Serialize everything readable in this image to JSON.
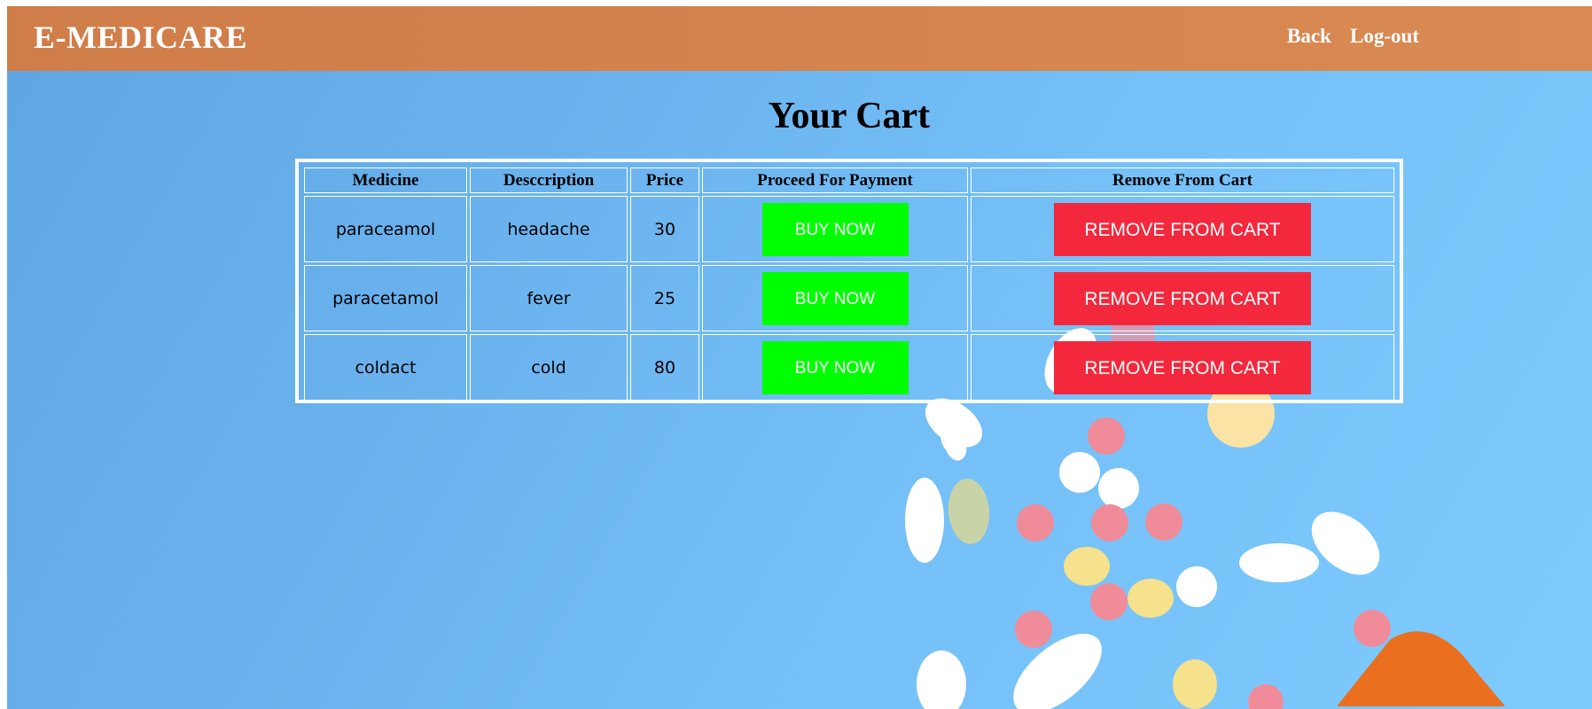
{
  "header": {
    "brand": "E-MEDICARE",
    "nav": {
      "back": "Back",
      "logout": "Log-out"
    }
  },
  "main": {
    "title": "Your Cart",
    "table": {
      "headers": [
        "Medicine",
        "Desccription",
        "Price",
        "Proceed For Payment",
        "Remove From Cart"
      ],
      "rows": [
        {
          "medicine": "paraceamol",
          "description": "headache",
          "price": "30",
          "buy_label": "BUY NOW",
          "remove_label": "REMOVE FROM CART"
        },
        {
          "medicine": "paracetamol",
          "description": "fever",
          "price": "25",
          "buy_label": "BUY NOW",
          "remove_label": "REMOVE FROM CART"
        },
        {
          "medicine": "coldact",
          "description": "cold",
          "price": "80",
          "buy_label": "BUY NOW",
          "remove_label": "REMOVE FROM CART"
        }
      ]
    }
  },
  "colors": {
    "navbar": "#d5834e",
    "background": "#6cb4ef",
    "buy_button": "#00ff00",
    "remove_button": "#f3283c"
  }
}
